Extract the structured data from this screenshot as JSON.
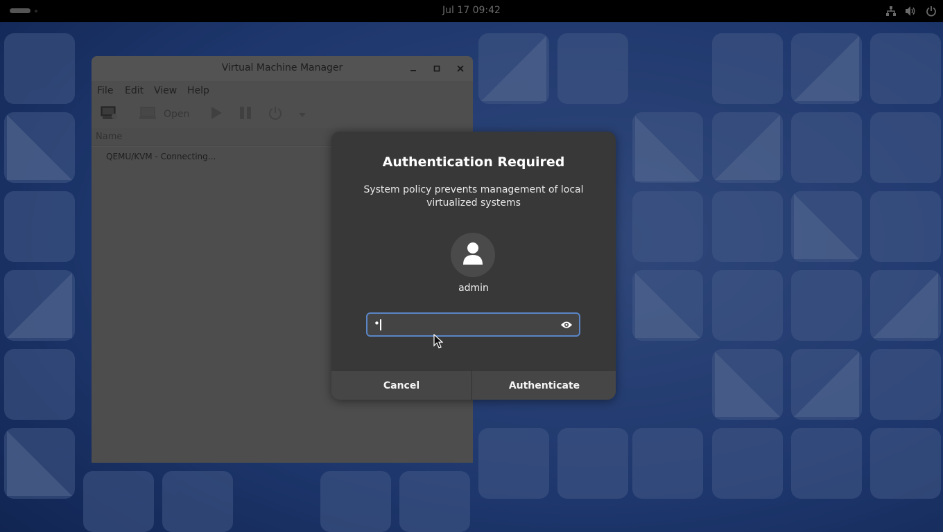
{
  "topbar": {
    "clock": "Jul 17  09:42",
    "tray_icons": [
      "network-icon",
      "volume-icon",
      "power-icon"
    ]
  },
  "vmm": {
    "title": "Virtual Machine Manager",
    "menu": [
      "File",
      "Edit",
      "View",
      "Help"
    ],
    "toolbar": {
      "open_label": "Open"
    },
    "column_name": "Name",
    "connection_row": "QEMU/KVM - Connecting..."
  },
  "auth": {
    "title": "Authentication Required",
    "message_line1": "System policy prevents management of local",
    "message_line2": "virtualized systems",
    "username": "admin",
    "password_masked": "•",
    "cancel_label": "Cancel",
    "authenticate_label": "Authenticate"
  },
  "colors": {
    "wallpaper": "#1d3f86",
    "dialog_bg": "#383838",
    "focus_ring": "#5a86c7"
  }
}
